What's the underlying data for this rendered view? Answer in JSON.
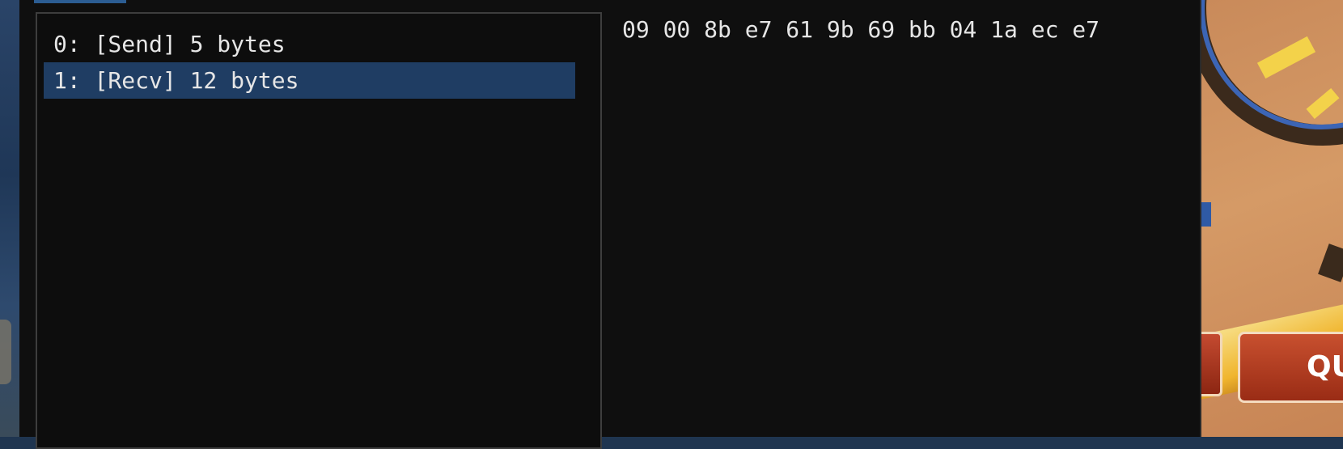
{
  "packet_list": {
    "items": [
      {
        "label": "0: [Send] 5 bytes",
        "selected": false
      },
      {
        "label": "1: [Recv] 12 bytes",
        "selected": true
      }
    ]
  },
  "hex_view": {
    "content": "09 00 8b e7 61 9b 69 bb 04 1a ec e7"
  },
  "game": {
    "quit_label": "QUIT"
  },
  "colors": {
    "selection": "#1f3d63",
    "window_bg": "#0f0f0f",
    "text": "#e6e6e6"
  }
}
